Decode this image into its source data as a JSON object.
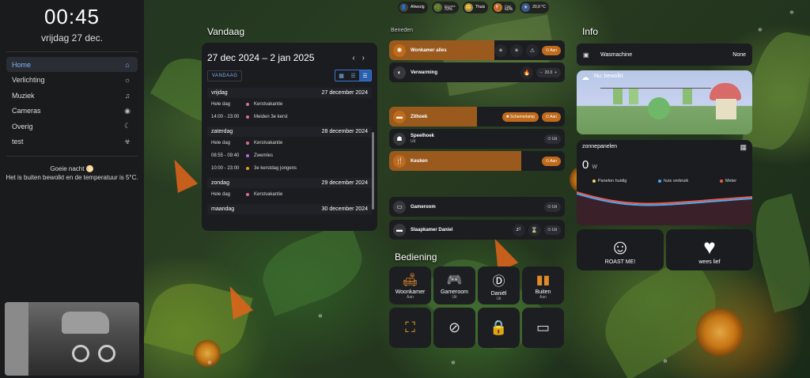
{
  "sidebar": {
    "time": "00:45",
    "date": "vrijdag 27 dec.",
    "items": [
      {
        "label": "Home",
        "icon": "home-icon",
        "glyph": "⌂"
      },
      {
        "label": "Verlichting",
        "icon": "lights-icon",
        "glyph": "☼"
      },
      {
        "label": "Muziek",
        "icon": "music-icon",
        "glyph": "♫"
      },
      {
        "label": "Cameras",
        "icon": "camera-icon",
        "glyph": "◉"
      },
      {
        "label": "Overig",
        "icon": "moon-icon",
        "glyph": "☾"
      },
      {
        "label": "test",
        "icon": "biohazard-icon",
        "glyph": "☣"
      }
    ],
    "greeting": "Goeie nacht 🌕",
    "weather_line": "Het is buiten bewolkt en de temperatuur is 5°C."
  },
  "status": [
    {
      "label": "Afwezig",
      "sub": ""
    },
    {
      "label": "70%",
      "sub": "Wonske"
    },
    {
      "label": "Thuis",
      "sub": ""
    },
    {
      "label": "60%",
      "sub": "Paul"
    },
    {
      "label": "20,0 °C",
      "sub": ""
    }
  ],
  "sections": {
    "today": "Vandaag",
    "control_top": "Beneden",
    "info": "Info",
    "bediening": "Bediening"
  },
  "calendar": {
    "range": "27 dec 2024 – 2 jan 2025",
    "today_btn": "VANDAAG",
    "days": [
      {
        "name": "vrijdag",
        "date": "27 december 2024",
        "events": [
          {
            "time": "Hele dag",
            "title": "Kerstvakantie",
            "color": "#e06a9a"
          },
          {
            "time": "14:00 - 23:00",
            "title": "Meiden 3e kerst",
            "color": "#e06a9a"
          }
        ]
      },
      {
        "name": "zaterdag",
        "date": "28 december 2024",
        "events": [
          {
            "time": "Hele dag",
            "title": "Kerstvakantie",
            "color": "#e06a9a"
          },
          {
            "time": "08:55 - 09:40",
            "title": "Zwemles",
            "color": "#b46ae0"
          },
          {
            "time": "10:00 - 23:00",
            "title": "3e kerstdag jongens",
            "color": "#e0a020"
          }
        ]
      },
      {
        "name": "zondag",
        "date": "29 december 2024",
        "events": [
          {
            "time": "Hele dag",
            "title": "Kerstvakantie",
            "color": "#e06a9a"
          }
        ]
      },
      {
        "name": "maandag",
        "date": "30 december 2024",
        "events": []
      }
    ]
  },
  "controls": [
    {
      "name": "Wonkamer alles",
      "sub": "",
      "state": "Aan",
      "on": true,
      "fill": 0.6,
      "extra": [
        "☀",
        "☀",
        "⚠"
      ]
    },
    {
      "name": "Verwarming",
      "sub": "",
      "state": "20.0",
      "on": false,
      "fill": 0,
      "extra": [
        "🔥",
        "−",
        "+"
      ]
    },
    {
      "name": "Zithoek",
      "sub": "",
      "state": "Aan",
      "on": true,
      "fill": 0.5,
      "extra": [
        "Schemerlamp"
      ]
    },
    {
      "name": "Speelhoek",
      "sub": "Uit",
      "state": "Uit",
      "on": false,
      "fill": 0,
      "extra": []
    },
    {
      "name": "Keuken",
      "sub": "",
      "state": "Aan",
      "on": true,
      "fill": 0.75,
      "extra": []
    },
    {
      "name": "Gameroom",
      "sub": "",
      "state": "Uit",
      "on": false,
      "fill": 0,
      "extra": []
    },
    {
      "name": "Slaapkamer Daniel",
      "sub": "",
      "state": "Uit",
      "on": false,
      "fill": 0,
      "extra": [
        "zᶻ",
        "⌛"
      ]
    }
  ],
  "tiles": [
    {
      "name": "Woonkamer",
      "sub": "Aan",
      "icon": "sofa-icon",
      "glyph": "🛋"
    },
    {
      "name": "Gameroom",
      "sub": "Uit",
      "icon": "gamepad-icon",
      "glyph": "🎮"
    },
    {
      "name": "Daniël",
      "sub": "Uit",
      "icon": "letter-d-icon",
      "glyph": "Ⓓ"
    },
    {
      "name": "Buiten",
      "sub": "Aan",
      "icon": "outdoor-lights-icon",
      "glyph": "▮▮"
    }
  ],
  "actions": [
    {
      "icon": "scan-icon",
      "glyph": "⛶"
    },
    {
      "icon": "vacuum-off-icon",
      "glyph": "⊘"
    },
    {
      "icon": "lock-rotate-icon",
      "glyph": "🔒"
    },
    {
      "icon": "tablet-icon",
      "glyph": "▭"
    }
  ],
  "info": {
    "washer_label": "Wasmachine",
    "washer_value": "None",
    "weather_title": "Nu: bewolkt",
    "solar_title": "zonnepanelen",
    "solar_value": "0",
    "solar_unit": "W",
    "legend": [
      {
        "label": "Panelen huidig",
        "color": "#f2d36b"
      },
      {
        "label": "huis verbruik",
        "color": "#4aa8f0"
      },
      {
        "label": "Meter",
        "color": "#f05a4a"
      }
    ],
    "roast_label": "ROAST ME!",
    "love_label": "wees lief"
  }
}
